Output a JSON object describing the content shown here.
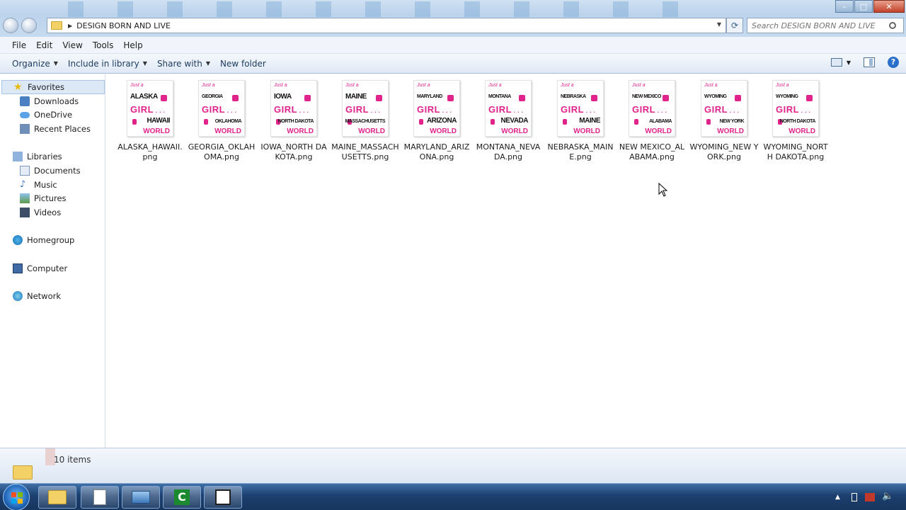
{
  "window": {
    "breadcrumb": "DESIGN BORN AND LIVE",
    "search_placeholder": "Search DESIGN BORN AND LIVE"
  },
  "menubar": [
    "File",
    "Edit",
    "View",
    "Tools",
    "Help"
  ],
  "toolbar": {
    "organize": "Organize",
    "include_in_library": "Include in library",
    "share_with": "Share with",
    "new_folder": "New folder"
  },
  "nav": {
    "favorites": "Favorites",
    "downloads": "Downloads",
    "onedrive": "OneDrive",
    "recent_places": "Recent Places",
    "libraries": "Libraries",
    "documents": "Documents",
    "music": "Music",
    "pictures": "Pictures",
    "videos": "Videos",
    "homegroup": "Homegroup",
    "computer": "Computer",
    "network": "Network"
  },
  "files": [
    {
      "name": "ALASKA_HAWAII.png",
      "top": "ALASKA",
      "bottom": "HAWAII"
    },
    {
      "name": "GEORGIA_OKLAHOMA.png",
      "top": "GEORGIA",
      "bottom": "OKLAHOMA"
    },
    {
      "name": "IOWA_NORTH DAKOTA.png",
      "top": "IOWA",
      "bottom": "NORTH DAKOTA"
    },
    {
      "name": "MAINE_MASSACHUSETTS.png",
      "top": "MAINE",
      "bottom": "MASSACHUSETTS"
    },
    {
      "name": "MARYLAND_ARIZONA.png",
      "top": "MARYLAND",
      "bottom": "ARIZONA"
    },
    {
      "name": "MONTANA_NEVADA.png",
      "top": "MONTANA",
      "bottom": "NEVADA"
    },
    {
      "name": "NEBRASKA_MAINE.png",
      "top": "NEBRASKA",
      "bottom": "MAINE"
    },
    {
      "name": "NEW MEXICO_ALABAMA.png",
      "top": "NEW MEXICO",
      "bottom": "ALABAMA"
    },
    {
      "name": "WYOMING_NEW YORK.png",
      "top": "WYOMING",
      "bottom": "NEW YORK"
    },
    {
      "name": "WYOMING_NORTH DAKOTA.png",
      "top": "WYOMING",
      "bottom": "NORTH DAKOTA"
    }
  ],
  "thumb_text": {
    "just_a": "Just a",
    "girl": "GIRL",
    "world": "WORLD"
  },
  "status": {
    "item_count": "10 items"
  },
  "colors": {
    "accent_pink": "#e0248c",
    "folder": "#f4d166",
    "taskbar": "#1c3f6e"
  }
}
